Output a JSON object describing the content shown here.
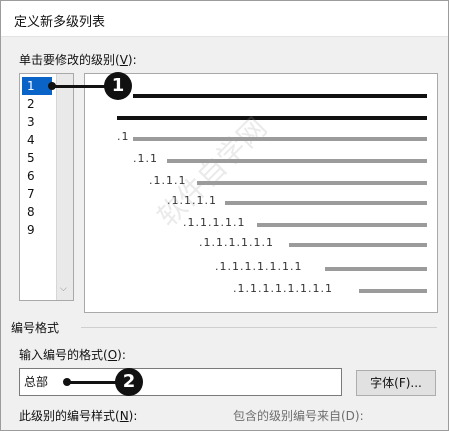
{
  "dialog": {
    "title": "定义新多级列表",
    "level_label": "单击要修改的级别(",
    "level_key": "V",
    "level_label_end": "):",
    "levels": [
      "1",
      "2",
      "3",
      "4",
      "5",
      "6",
      "7",
      "8",
      "9"
    ],
    "selected_level": "1",
    "number_format_section": "编号格式",
    "input_format_label": "输入编号的格式(",
    "input_format_key": "O",
    "input_format_end": "):",
    "input_format_value": "总部",
    "font_button": "字体(F)...",
    "style_label": "此级别的编号样式(",
    "style_key": "N",
    "style_end": "):",
    "include_label": "包含的级别编号来自(D):"
  },
  "preview": {
    "numbers": [
      ".1",
      ".1.1",
      ".1.1.1",
      ".1.1.1.1",
      ".1.1.1.1.1",
      ".1.1.1.1.1.1",
      ".1.1.1.1.1.1.1",
      ".1.1.1.1.1.1.1.1"
    ]
  },
  "callouts": [
    "1",
    "2"
  ],
  "watermark": "软件自学网"
}
